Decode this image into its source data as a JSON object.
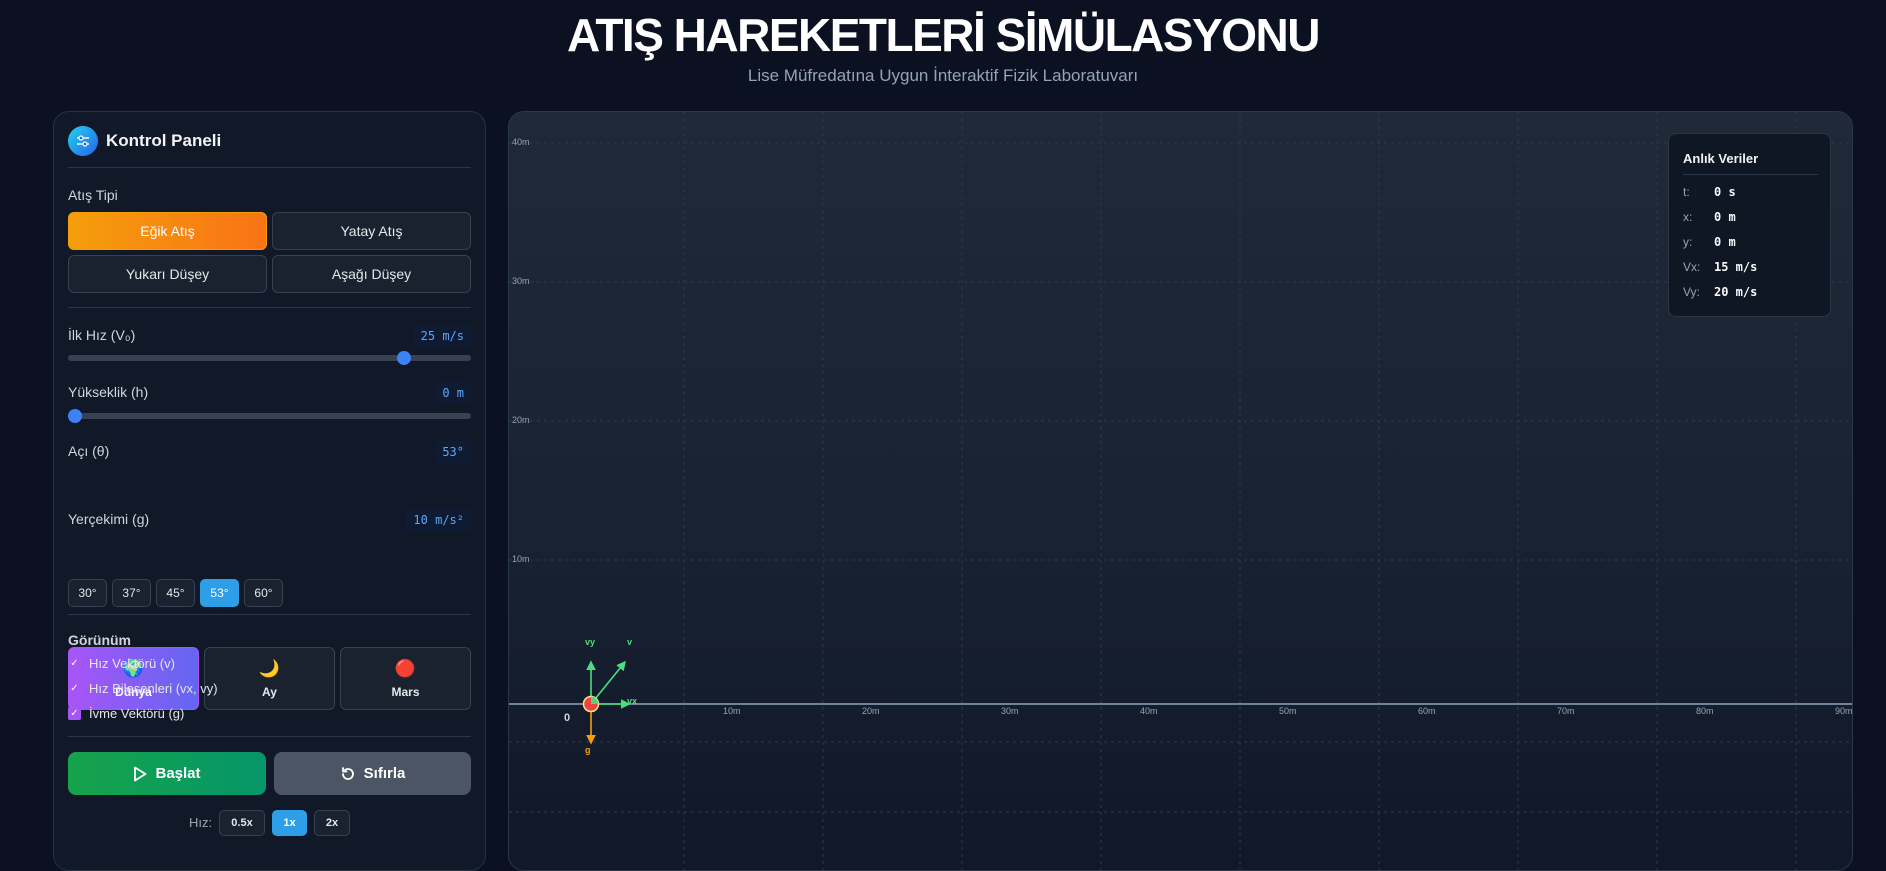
{
  "header": {
    "title": "ATIŞ HAREKETLERİ SİMÜLASYONU",
    "subtitle": "Lise Müfredatına Uygun İnteraktif Fizik Laboratuvarı"
  },
  "panel": {
    "title": "Kontrol Paneli",
    "icon": "sliders-icon",
    "launch_type": {
      "label": "Atış Tipi",
      "options": [
        "Eğik Atış",
        "Yatay Atış",
        "Yukarı Düşey",
        "Aşağı Düşey"
      ],
      "selected": "Eğik Atış"
    },
    "speed": {
      "label": "İlk Hız (V₀)",
      "value_text": "25 m/s",
      "value": 25,
      "min": 0,
      "max": 30
    },
    "height": {
      "label": "Yükseklik (h)",
      "value_text": "0 m",
      "value": 0
    },
    "angle": {
      "label": "Açı (θ)",
      "value_text": "53°",
      "presets": [
        "30°",
        "37°",
        "45°",
        "53°",
        "60°"
      ],
      "selected": "53°"
    },
    "gravity": {
      "label": "Yerçekimi (g)",
      "value_text": "10 m/s²",
      "planets": [
        {
          "name": "Dünya",
          "icon": "earth-icon",
          "glyph": "🌍"
        },
        {
          "name": "Ay",
          "icon": "moon-icon",
          "glyph": "🌙"
        },
        {
          "name": "Mars",
          "icon": "mars-icon",
          "glyph": "🔴"
        }
      ],
      "selected": "Dünya"
    },
    "view": {
      "label": "Görünüm",
      "options": [
        {
          "label": "Hız Vektörü (v)",
          "checked": true
        },
        {
          "label": "Hız Bileşenleri (vx, vy)",
          "checked": true
        },
        {
          "label": "İvme Vektörü (g)",
          "checked": true
        }
      ]
    },
    "start_label": "Başlat",
    "reset_label": "Sıfırla",
    "playback": {
      "label": "Hız:",
      "options": [
        "0.5x",
        "1x",
        "2x"
      ],
      "selected": "1x"
    }
  },
  "sim": {
    "y_ticks": [
      "40m",
      "30m",
      "20m",
      "10m"
    ],
    "x_ticks": [
      "10m",
      "20m",
      "30m",
      "40m",
      "50m",
      "60m",
      "70m",
      "80m",
      "90m"
    ],
    "origin_label": "0",
    "vector_labels": {
      "v": "v",
      "vx": "vx",
      "vy": "vy",
      "g": "g"
    },
    "colors": {
      "vx": "#4ade80",
      "vy": "#4ade80",
      "v": "#4ade80",
      "g": "#f59e0b",
      "ball": "#ef4444"
    }
  },
  "live_data": {
    "title": "Anlık Veriler",
    "rows": [
      {
        "key": "t:",
        "value": "0 s"
      },
      {
        "key": "x:",
        "value": "0 m"
      },
      {
        "key": "y:",
        "value": "0 m"
      },
      {
        "key": "Vx:",
        "value": "15 m/s"
      },
      {
        "key": "Vy:",
        "value": "20 m/s"
      }
    ]
  }
}
